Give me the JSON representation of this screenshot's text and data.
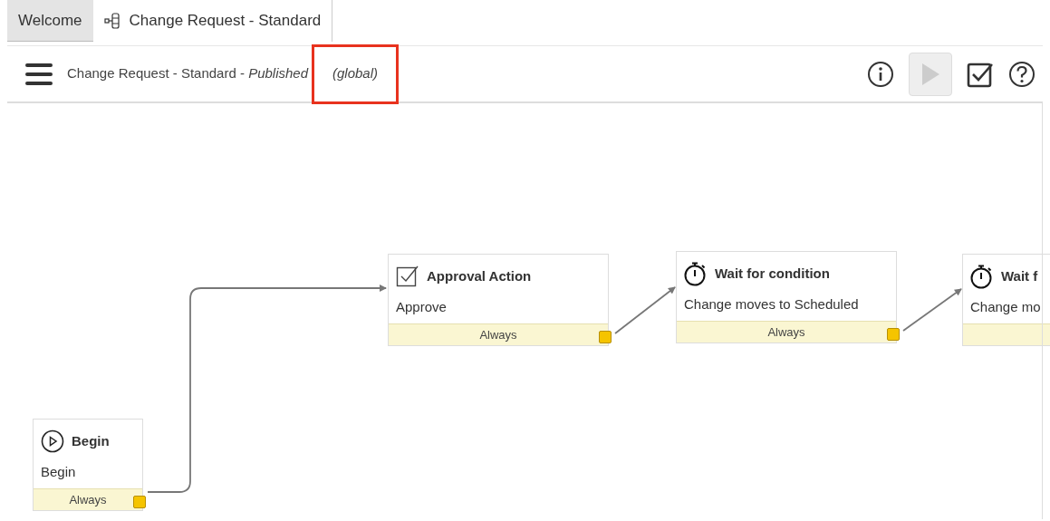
{
  "tabs": [
    {
      "label": "Welcome",
      "selected": false,
      "kind": "plain"
    },
    {
      "label": "Change Request - Standard",
      "selected": true,
      "kind": "workflow"
    }
  ],
  "header": {
    "title": "Change Request - Standard - ",
    "status": "Published",
    "scope": "(global)",
    "run_disabled": true
  },
  "nodes": [
    {
      "kind": "begin",
      "title": "Begin",
      "subtitle": "Begin",
      "footer": "Always"
    },
    {
      "kind": "approval",
      "title": "Approval Action",
      "subtitle": "Approve",
      "footer": "Always"
    },
    {
      "kind": "timer",
      "title": "Wait for condition",
      "subtitle": "Change moves to Scheduled",
      "footer": "Always"
    },
    {
      "kind": "timer",
      "title": "Wait f",
      "subtitle": "Change mo"
    }
  ]
}
